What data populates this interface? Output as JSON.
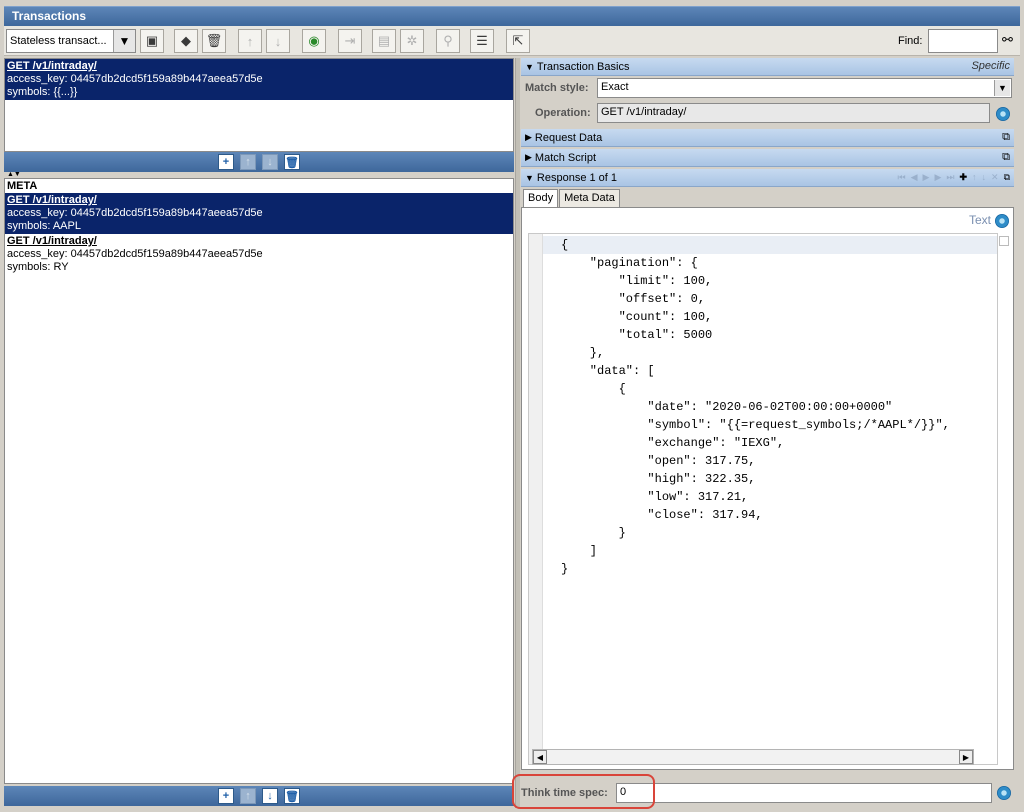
{
  "window": {
    "title": "Transactions"
  },
  "toolbar": {
    "mode_value": "Stateless transact...",
    "find_label": "Find:",
    "find_value": ""
  },
  "transactions": [
    {
      "operation": "GET /v1/intraday/",
      "params": [
        "access_key: 04457db2dcd5f159a89b447aeea57d5e",
        "symbols: {{...}}"
      ],
      "selected": true
    }
  ],
  "meta": {
    "heading": "META",
    "items": [
      {
        "operation": "GET /v1/intraday/",
        "params": [
          "access_key: 04457db2dcd5f159a89b447aeea57d5e",
          "symbols: AAPL"
        ],
        "selected": true
      },
      {
        "operation": "GET /v1/intraday/",
        "params": [
          "access_key: 04457db2dcd5f159a89b447aeea57d5e",
          "symbols: RY"
        ],
        "selected": false
      }
    ]
  },
  "basics": {
    "title": "Transaction Basics",
    "specific": "Specific",
    "match_style_label": "Match style:",
    "match_style_value": "Exact",
    "operation_label": "Operation:",
    "operation_value": "GET /v1/intraday/"
  },
  "sections": {
    "request_data": "Request Data",
    "match_script": "Match Script",
    "response": "Response 1 of 1"
  },
  "response_tabs": [
    "Body",
    "Meta Data"
  ],
  "body": {
    "format": "Text",
    "lines": [
      "{",
      "    \"pagination\": {",
      "        \"limit\": 100,",
      "        \"offset\": 0,",
      "        \"count\": 100,",
      "        \"total\": 5000",
      "    },",
      "    \"data\": [",
      "        {",
      "            \"date\": \"2020-06-02T00:00:00+0000\"",
      "            \"symbol\": \"{{=request_symbols;/*AAPL*/}}\",",
      "            \"exchange\": \"IEXG\",",
      "            \"open\": 317.75,",
      "            \"high\": 322.35,",
      "            \"low\": 317.21,",
      "            \"close\": 317.94,",
      "        }",
      "    ]",
      "}"
    ]
  },
  "think_time": {
    "label": "Think time spec:",
    "value": "0"
  },
  "colors": {
    "accent": "#3e679b",
    "selection": "#0a246a",
    "highlight": "#d9453a"
  }
}
